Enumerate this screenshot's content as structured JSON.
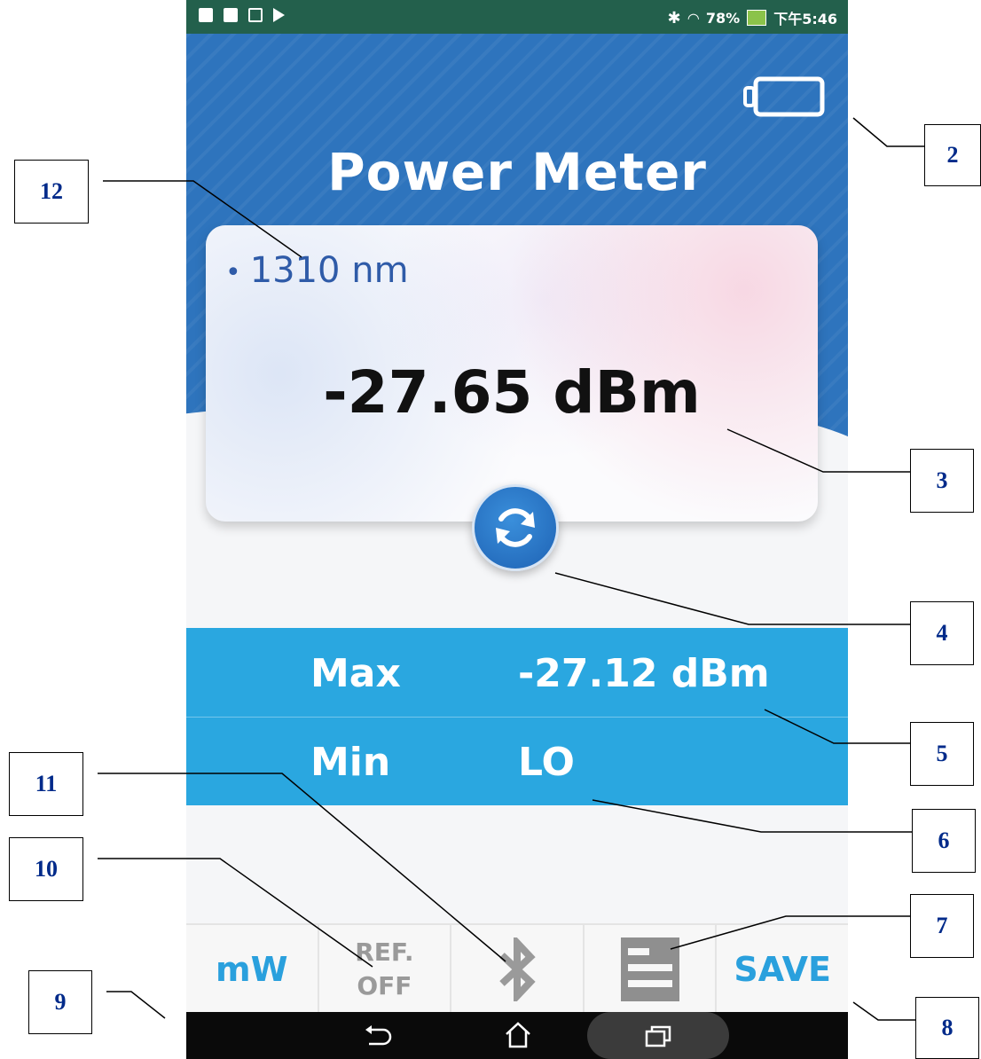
{
  "status_bar": {
    "battery_percent": "78%",
    "time": "下午5:46"
  },
  "header": {
    "title": "Power Meter"
  },
  "card": {
    "wavelength": "1310 nm",
    "reading": "-27.65 dBm"
  },
  "stats": {
    "max_label": "Max",
    "max_value": "-27.12 dBm",
    "min_label": "Min",
    "min_value": "LO"
  },
  "toolbar": {
    "unit_label": "mW",
    "ref_line1": "REF.",
    "ref_line2": "OFF",
    "save_label": "SAVE"
  },
  "callouts": {
    "c2": "2",
    "c3": "3",
    "c4": "4",
    "c5": "5",
    "c6": "6",
    "c7": "7",
    "c8": "8",
    "c9": "9",
    "c10": "10",
    "c11": "11",
    "c12": "12"
  },
  "colors": {
    "header_blue": "#2e74bd",
    "stats_blue": "#2aa7e0",
    "accent_blue": "#2aa0dd",
    "status_green": "#23604c"
  },
  "icons": {
    "battery": "battery-icon",
    "refresh": "refresh-icon",
    "bluetooth": "bluetooth-icon",
    "list": "list-icon",
    "back": "back-icon",
    "home": "home-icon",
    "recents": "recents-icon"
  }
}
